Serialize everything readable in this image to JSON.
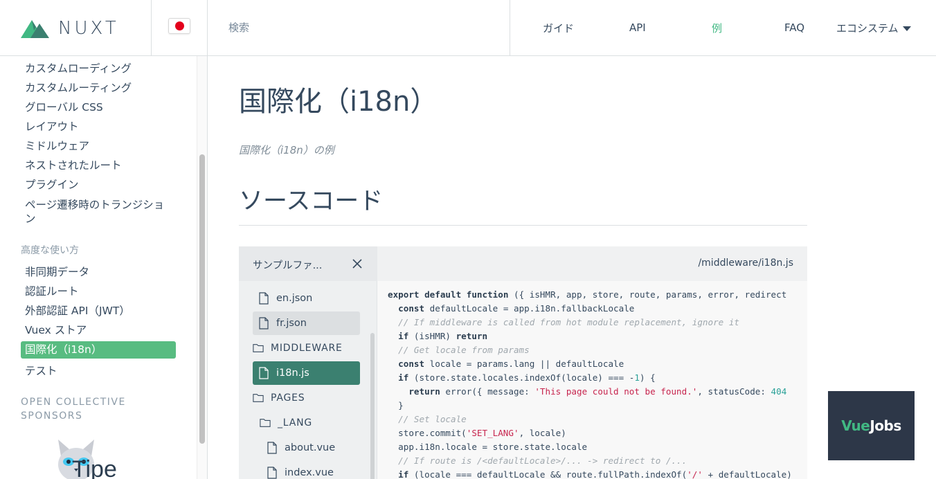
{
  "header": {
    "logo_text": "NUXT",
    "language_flag": "japan-flag-icon",
    "search_placeholder": "検索",
    "nav": [
      {
        "label": "ガイド"
      },
      {
        "label": "API"
      },
      {
        "label": "例",
        "active": true
      },
      {
        "label": "FAQ"
      },
      {
        "label": "エコシステム"
      }
    ]
  },
  "sidebar": {
    "items_top": [
      "カスタムローディング",
      "カスタムルーティング",
      "グローバル CSS",
      "レイアウト",
      "ミドルウェア",
      "ネストされたルート",
      "プラグイン",
      "ページ遷移時のトランジション"
    ],
    "advanced_heading": "高度な使い方",
    "advanced_items": [
      "非同期データ",
      "認証ルート",
      "外部認証 API（JWT）",
      "Vuex ストア",
      "国際化（i18n）",
      "テスト"
    ],
    "active_item": "国際化（i18n）",
    "sponsors_heading": "OPEN COLLECTIVE SPONSORS",
    "sponsor_name": "Tipe"
  },
  "main": {
    "title": "国際化（i18n）",
    "description": "国際化（i18n）の例",
    "source_heading": "ソースコード"
  },
  "viewer": {
    "panel_title": "サンプルファ...",
    "current_path": "/middleware/i18n.js",
    "tree": [
      {
        "label": "en.json",
        "type": "file"
      },
      {
        "label": "fr.json",
        "type": "file",
        "state": "hover"
      },
      {
        "label": "MIDDLEWARE",
        "type": "folder"
      },
      {
        "label": "i18n.js",
        "type": "file",
        "state": "current"
      },
      {
        "label": "PAGES",
        "type": "folder"
      },
      {
        "label": "_LANG",
        "type": "folder"
      },
      {
        "label": "about.vue",
        "type": "file"
      },
      {
        "label": "index.vue",
        "type": "file"
      }
    ],
    "code_lines": [
      "export default function ({ isHMR, app, store, route, params, error, redirect",
      "  const defaultLocale = app.i18n.fallbackLocale",
      "  // If middleware is called from hot module replacement, ignore it",
      "  if (isHMR) return",
      "  // Get locale from params",
      "  const locale = params.lang || defaultLocale",
      "  if (store.state.locales.indexOf(locale) === -1) {",
      "    return error({ message: 'This page could not be found.', statusCode: 404",
      "  }",
      "  // Set locale",
      "  store.commit('SET_LANG', locale)",
      "  app.i18n.locale = store.state.locale",
      "  // If route is /<defaultLocale>/... -> redirect to /...",
      "  if (locale === defaultLocale && route.fullPath.indexOf('/' + defaultLocale)"
    ]
  },
  "ad": {
    "brand_a": "Vue",
    "brand_b": "Jobs"
  },
  "colors": {
    "accent": "#41b883",
    "active_bg": "#58bc81",
    "current_file_bg": "#3b8070",
    "text": "#35495e",
    "ad_bg": "#2d3748"
  }
}
